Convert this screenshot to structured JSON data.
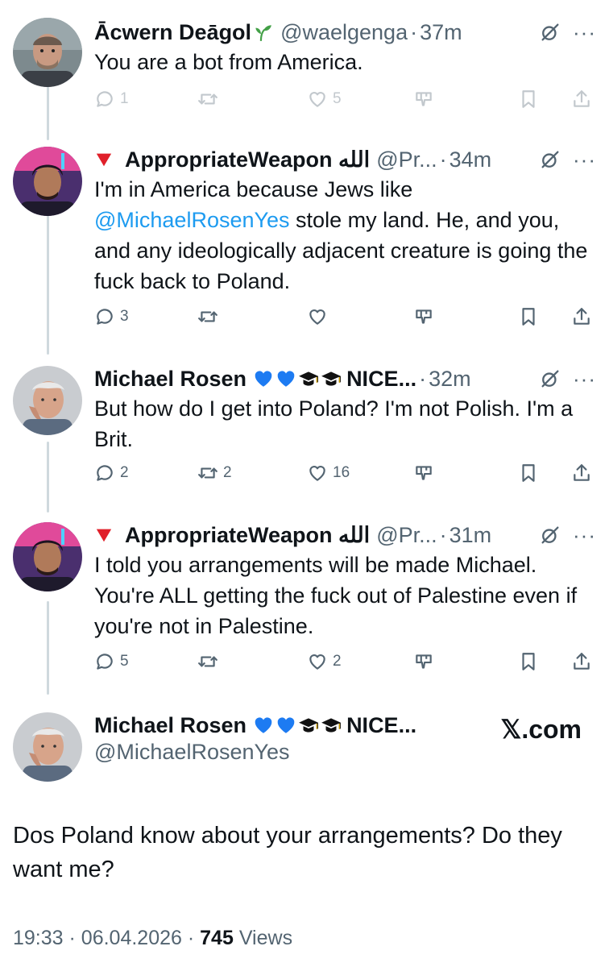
{
  "tweets": [
    {
      "name": "Ācwern Deāgol",
      "handle": "@waelgenga",
      "time": "37m",
      "text": "You are a bot from America.",
      "replies": "1",
      "retweets": "",
      "likes": "5"
    },
    {
      "name": "AppropriateWeapon الله",
      "handle": "@Pr...",
      "time": "34m",
      "text_before": "I'm in America because Jews like ",
      "mention": "@MichaelRosenYes",
      "text_after": " stole my land. He, and you, and any ideologically adjacent creature is going the fuck back to Poland.",
      "replies": "3",
      "retweets": "",
      "likes": ""
    },
    {
      "name": "Michael Rosen",
      "name_suffix": "NICE...",
      "time": "32m",
      "text": "But how do I get into Poland?  I'm not Polish. I'm a Brit.",
      "replies": "2",
      "retweets": "2",
      "likes": "16"
    },
    {
      "name": "AppropriateWeapon الله",
      "handle": "@Pr...",
      "time": "31m",
      "text": "I told you arrangements will be made Michael. You're ALL getting the fuck out of Palestine even if you're not in Palestine.",
      "replies": "5",
      "retweets": "",
      "likes": "2"
    }
  ],
  "main_tweet": {
    "name": "Michael Rosen",
    "name_suffix": "NICE...",
    "handle": "@MichaelRosenYes",
    "watermark": "𝕏.com",
    "text": "Dos Poland know about your arrangements? Do they want me?",
    "time": "19:33",
    "date": "06.04.2026",
    "views_count": "745",
    "views_label": "Views"
  },
  "separator": "·",
  "more": "···",
  "colors": {
    "link": "#1d9bf0",
    "secondary": "#536471",
    "text": "#0f1419",
    "thread": "#cfd9de"
  },
  "icons": [
    "reply-icon",
    "retweet-icon",
    "like-icon",
    "tip-icon",
    "bookmark-icon",
    "share-icon",
    "grok-icon",
    "more-icon"
  ]
}
